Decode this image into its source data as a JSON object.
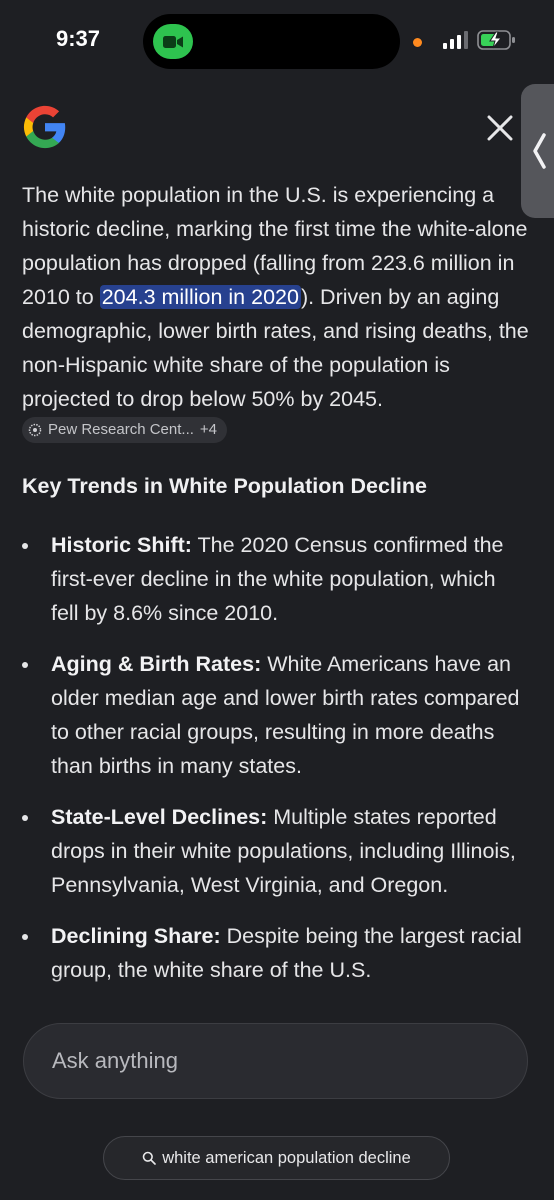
{
  "status_bar": {
    "time": "9:37"
  },
  "answer": {
    "text_before": "The white population in the U.S. is experiencing a historic decline, marking the first time the white-alone population has dropped (falling from 223.6 million in 2010 to ",
    "highlight": "204.3 million in 2020",
    "text_after": "). Driven by an aging demographic, lower birth rates, and rising deaths, the non-Hispanic white share of the population is projected to drop below 50% by 2045. ",
    "source_chip": {
      "label": "Pew Research Cent...",
      "more": "+4"
    }
  },
  "section_title": "Key Trends in White Population Decline",
  "bullets": [
    {
      "title": "Historic Shift:",
      "text": " The 2020 Census confirmed the first-ever decline in the white population, which fell by 8.6% since 2010."
    },
    {
      "title": "Aging & Birth Rates:",
      "text": " White Americans have an older median age and lower birth rates compared to other racial groups, resulting in more deaths than births in many states."
    },
    {
      "title": "State-Level Declines:",
      "text": " Multiple states reported drops in their white populations, including Illinois, Pennsylvania, West Virginia, and Oregon."
    },
    {
      "title": "Declining Share:",
      "text": " Despite being the largest racial group, the white share of the U.S."
    }
  ],
  "ask_bar": {
    "placeholder": "Ask anything"
  },
  "query_chip": {
    "label": "white american population decline"
  },
  "colors": {
    "background": "#1e1f23",
    "highlight": "#27418f",
    "facetime_green": "#2ec34f",
    "privacy_dot": "#ff8a1f"
  },
  "icons": [
    "google-logo-icon",
    "close-icon",
    "chevron-left-icon",
    "video-camera-icon",
    "signal-icon",
    "battery-charging-icon",
    "source-favicon-icon",
    "search-icon"
  ]
}
